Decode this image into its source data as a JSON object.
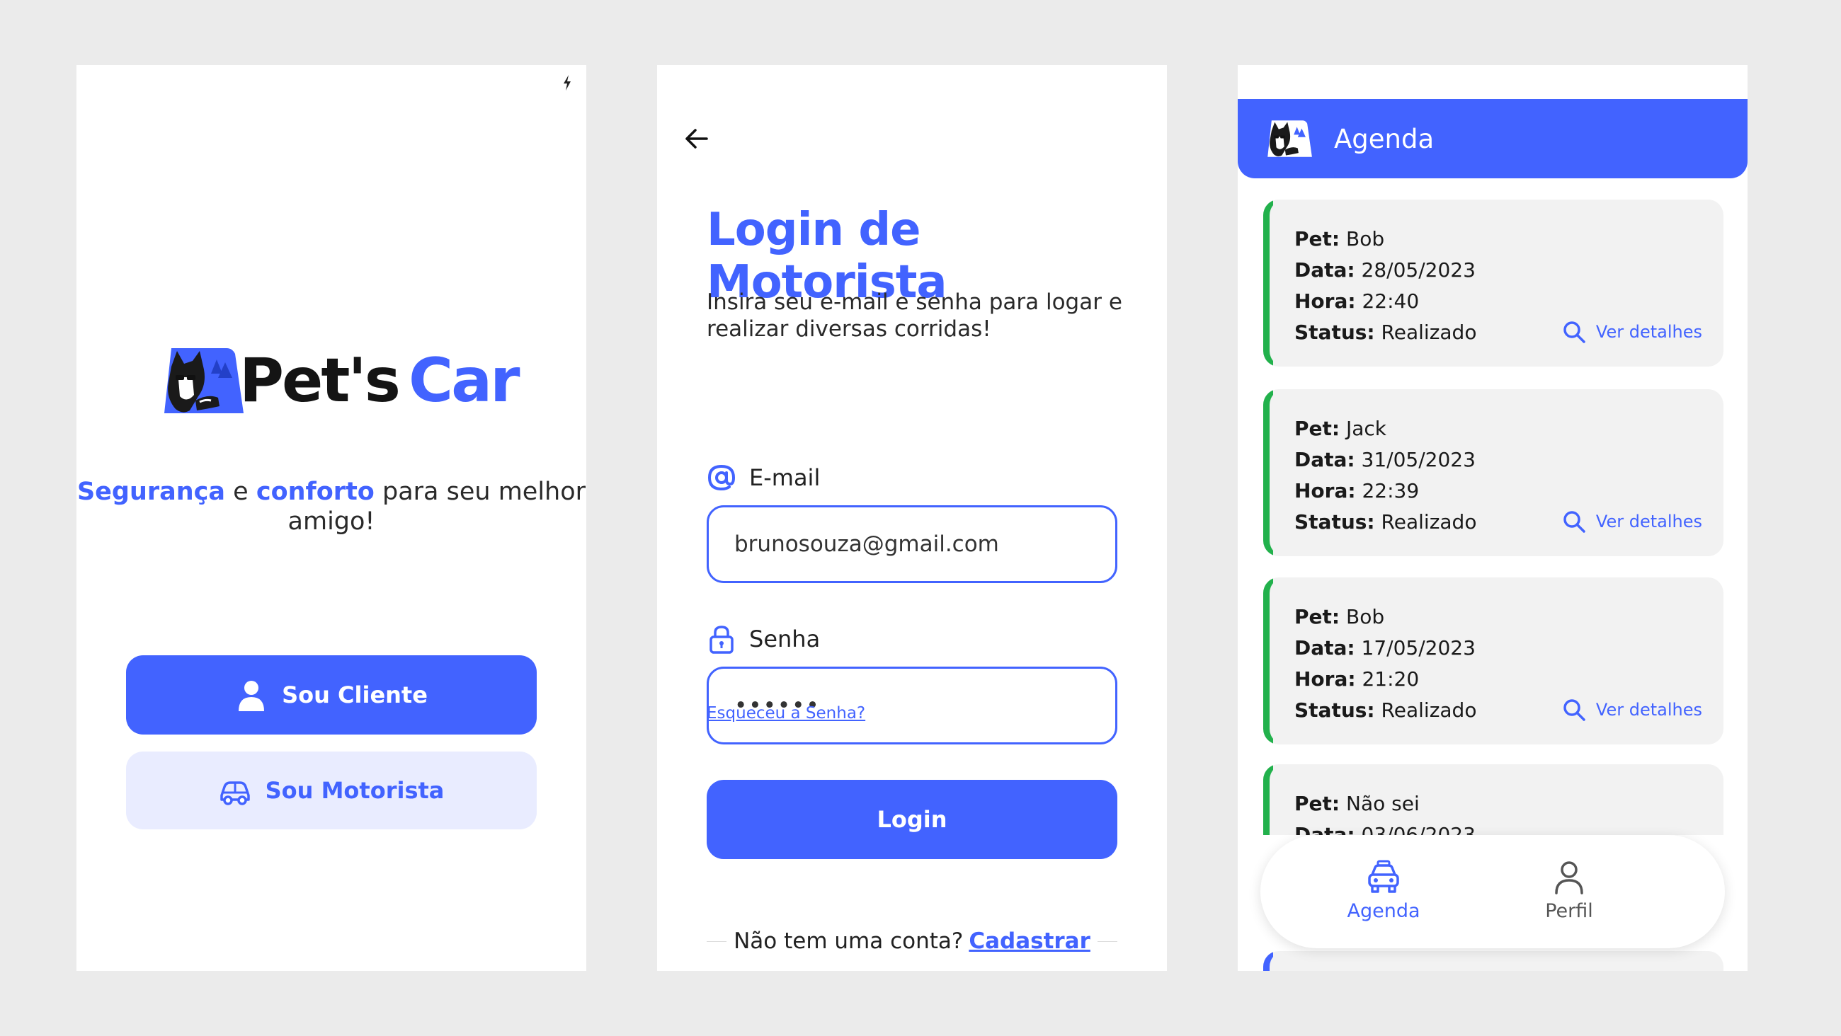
{
  "colors": {
    "primary": "#4263ff",
    "primary_light": "#e9ecff",
    "success": "#22b14c",
    "card_bg": "#f2f2f2",
    "background": "#ebebeb"
  },
  "welcome": {
    "brand_pets": "Pet's",
    "brand_car": "Car",
    "tagline_bold1": "Segurança",
    "tagline_mid": " e ",
    "tagline_bold2": "conforto",
    "tagline_rest": " para seu melhor amigo!",
    "client_button": "Sou Cliente",
    "driver_button": "Sou Motorista",
    "icons": [
      "bolt-icon",
      "husky-logo-icon",
      "user-icon",
      "car-icon"
    ]
  },
  "login": {
    "title": "Login de Motorista",
    "subtitle": "Insira seu e-mail e senha para logar e realizar diversas corridas!",
    "email_label": "E-mail",
    "email_value": "brunosouza@gmail.com",
    "password_label": "Senha",
    "password_value": "••••••",
    "forgot_link": "Esqueceu a Senha?",
    "login_button": "Login",
    "no_account_text": "Não tem uma conta?",
    "signup_link": "Cadastrar",
    "icons": [
      "back-arrow-icon",
      "at-sign-icon",
      "lock-icon"
    ]
  },
  "agenda": {
    "header_title": "Agenda",
    "details_label": "Ver detalhes",
    "field_labels": {
      "pet": "Pet:",
      "date": "Data:",
      "time": "Hora:",
      "status": "Status:"
    },
    "appointments": [
      {
        "pet": "Bob",
        "date": "28/05/2023",
        "time": "22:40",
        "status": "Realizado"
      },
      {
        "pet": "Jack",
        "date": "31/05/2023",
        "time": "22:39",
        "status": "Realizado"
      },
      {
        "pet": "Bob",
        "date": "17/05/2023",
        "time": "21:20",
        "status": "Realizado"
      },
      {
        "pet": "Não sei",
        "date": "03/06/2023",
        "time": "",
        "status": ""
      }
    ],
    "nav": [
      {
        "label": "Agenda",
        "icon": "car-front-icon",
        "active": true
      },
      {
        "label": "Perfil",
        "icon": "user-outline-icon",
        "active": false
      }
    ]
  }
}
